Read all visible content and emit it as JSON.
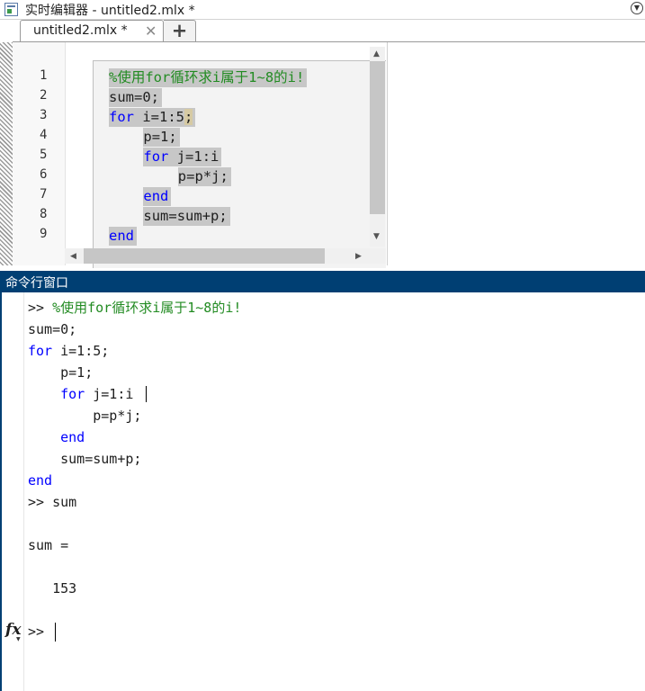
{
  "window": {
    "title": "实时编辑器 - untitled2.mlx *"
  },
  "tabs": [
    {
      "label": "untitled2.mlx *",
      "close_symbol": "✕"
    }
  ],
  "add_tab_symbol": "+",
  "editor": {
    "line_numbers": [
      "1",
      "2",
      "3",
      "4",
      "5",
      "6",
      "7",
      "8",
      "9"
    ],
    "lines": [
      {
        "indent": "",
        "segments": [
          {
            "type": "comment",
            "text": "%使用for循环求i属于1~8的i!"
          }
        ]
      },
      {
        "indent": "",
        "segments": [
          {
            "type": "text",
            "text": "sum=0;"
          }
        ]
      },
      {
        "indent": "",
        "segments": [
          {
            "type": "keyword",
            "text": "for"
          },
          {
            "type": "text",
            "text": " i=1:5"
          },
          {
            "type": "caret",
            "text": ";"
          }
        ]
      },
      {
        "indent": "    ",
        "segments": [
          {
            "type": "text",
            "text": "p=1;"
          }
        ]
      },
      {
        "indent": "    ",
        "segments": [
          {
            "type": "keyword",
            "text": "for"
          },
          {
            "type": "text",
            "text": " j=1:i"
          }
        ]
      },
      {
        "indent": "        ",
        "segments": [
          {
            "type": "text",
            "text": "p=p*j;"
          }
        ]
      },
      {
        "indent": "    ",
        "segments": [
          {
            "type": "keyword",
            "text": "end"
          }
        ]
      },
      {
        "indent": "    ",
        "segments": [
          {
            "type": "text",
            "text": "sum=sum+p;"
          }
        ]
      },
      {
        "indent": "",
        "segments": [
          {
            "type": "keyword",
            "text": "end"
          }
        ]
      }
    ]
  },
  "command_window": {
    "title": "命令行窗口",
    "lines": [
      {
        "segments": [
          {
            "type": "text",
            "text": ">> "
          },
          {
            "type": "comment",
            "text": "%使用for循环求i属于1~8的i!"
          }
        ]
      },
      {
        "segments": [
          {
            "type": "text",
            "text": "sum=0;"
          }
        ]
      },
      {
        "segments": [
          {
            "type": "keyword",
            "text": "for"
          },
          {
            "type": "text",
            "text": " i=1:5;"
          }
        ]
      },
      {
        "segments": [
          {
            "type": "text",
            "text": "    p=1;"
          }
        ]
      },
      {
        "segments": [
          {
            "type": "text",
            "text": "    "
          },
          {
            "type": "keyword",
            "text": "for"
          },
          {
            "type": "text",
            "text": " j=1:i"
          }
        ]
      },
      {
        "segments": [
          {
            "type": "text",
            "text": "        p=p*j;"
          }
        ]
      },
      {
        "segments": [
          {
            "type": "text",
            "text": "    "
          },
          {
            "type": "keyword",
            "text": "end"
          }
        ]
      },
      {
        "segments": [
          {
            "type": "text",
            "text": "    sum=sum+p;"
          }
        ]
      },
      {
        "segments": [
          {
            "type": "keyword",
            "text": "end"
          }
        ]
      },
      {
        "segments": [
          {
            "type": "text",
            "text": ">> sum"
          }
        ]
      },
      {
        "segments": []
      },
      {
        "segments": [
          {
            "type": "text",
            "text": "sum ="
          }
        ]
      },
      {
        "segments": []
      },
      {
        "segments": [
          {
            "type": "text",
            "text": "   153"
          }
        ]
      },
      {
        "segments": []
      },
      {
        "segments": [
          {
            "type": "text",
            "text": ">> "
          }
        ]
      }
    ],
    "fx_label": "fx"
  },
  "colors": {
    "keyword": "#0000ff",
    "comment": "#228b22",
    "text": "#1e1e1e",
    "header": "#003f73"
  }
}
